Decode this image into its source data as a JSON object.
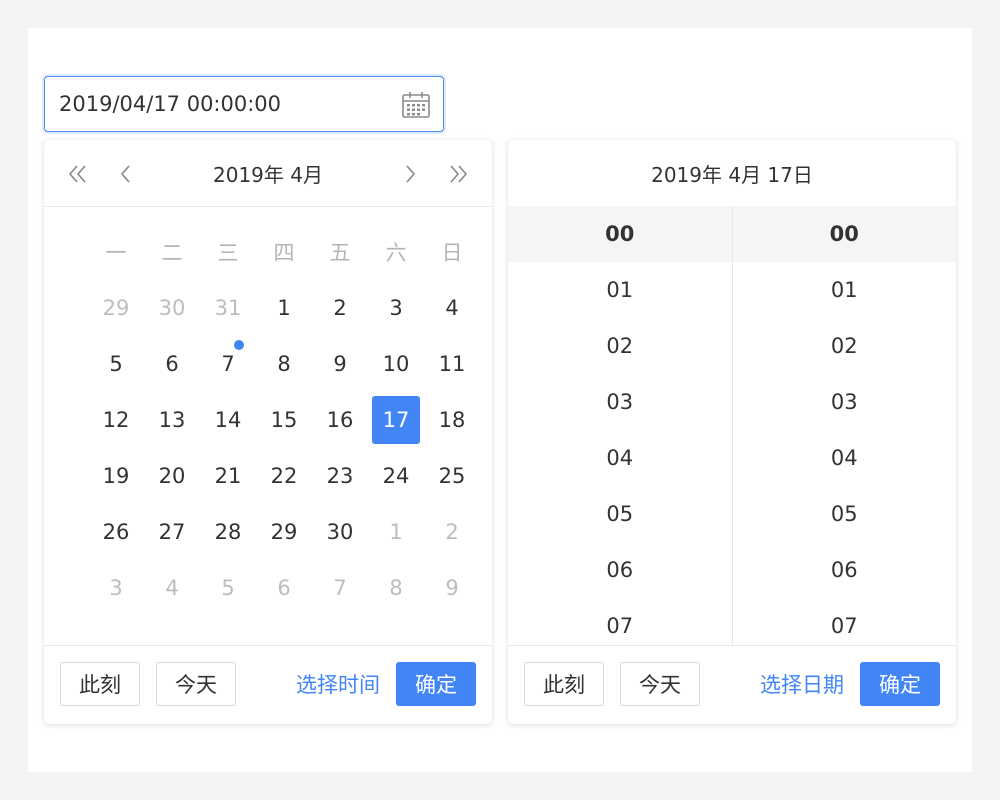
{
  "input": {
    "value": "2019/04/17 00:00:00",
    "icon": "calendar-icon"
  },
  "date_panel": {
    "header_title": "2019年 4月",
    "weekdays": [
      "一",
      "二",
      "三",
      "四",
      "五",
      "六",
      "日"
    ],
    "weeks": [
      [
        {
          "d": "29",
          "m": true
        },
        {
          "d": "30",
          "m": true
        },
        {
          "d": "31",
          "m": true
        },
        {
          "d": "1"
        },
        {
          "d": "2"
        },
        {
          "d": "3"
        },
        {
          "d": "4"
        }
      ],
      [
        {
          "d": "5"
        },
        {
          "d": "6"
        },
        {
          "d": "7",
          "today": true
        },
        {
          "d": "8"
        },
        {
          "d": "9"
        },
        {
          "d": "10"
        },
        {
          "d": "11"
        }
      ],
      [
        {
          "d": "12"
        },
        {
          "d": "13"
        },
        {
          "d": "14"
        },
        {
          "d": "15"
        },
        {
          "d": "16"
        },
        {
          "d": "17",
          "sel": true
        },
        {
          "d": "18"
        }
      ],
      [
        {
          "d": "19"
        },
        {
          "d": "20"
        },
        {
          "d": "21"
        },
        {
          "d": "22"
        },
        {
          "d": "23"
        },
        {
          "d": "24"
        },
        {
          "d": "25"
        }
      ],
      [
        {
          "d": "26"
        },
        {
          "d": "27"
        },
        {
          "d": "28"
        },
        {
          "d": "29"
        },
        {
          "d": "30"
        },
        {
          "d": "1",
          "m": true
        },
        {
          "d": "2",
          "m": true
        }
      ],
      [
        {
          "d": "3",
          "m": true
        },
        {
          "d": "4",
          "m": true
        },
        {
          "d": "5",
          "m": true
        },
        {
          "d": "6",
          "m": true
        },
        {
          "d": "7",
          "m": true
        },
        {
          "d": "8",
          "m": true
        },
        {
          "d": "9",
          "m": true
        }
      ]
    ],
    "footer": {
      "now_label": "此刻",
      "today_label": "今天",
      "switch_label": "选择时间",
      "ok_label": "确定"
    }
  },
  "time_panel": {
    "header_title": "2019年 4月 17日",
    "hours": [
      "00",
      "01",
      "02",
      "03",
      "04",
      "05",
      "06",
      "07"
    ],
    "minutes": [
      "00",
      "01",
      "02",
      "03",
      "04",
      "05",
      "06",
      "07"
    ],
    "selected_hour": "00",
    "selected_minute": "00",
    "footer": {
      "now_label": "此刻",
      "today_label": "今天",
      "switch_label": "选择日期",
      "ok_label": "确定"
    }
  },
  "colors": {
    "accent": "#4285f4",
    "muted_text": "#bdbdbd",
    "border": "#e8e8e8"
  }
}
